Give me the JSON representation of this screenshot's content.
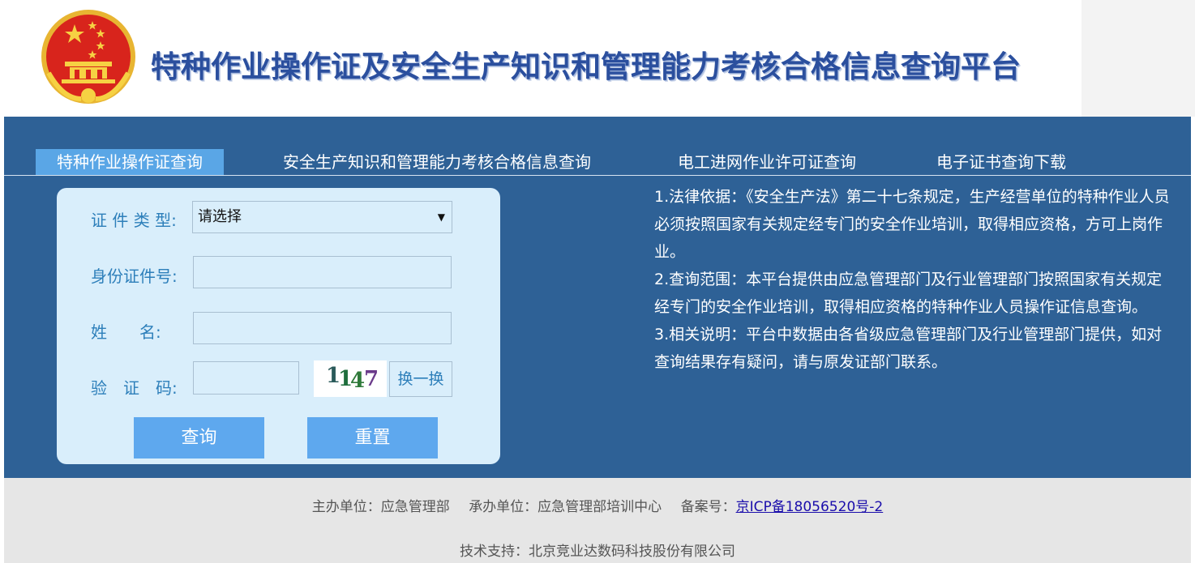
{
  "header": {
    "title": "特种作业操作证及安全生产知识和管理能力考核合格信息查询平台"
  },
  "tabs": [
    {
      "label": "特种作业操作证查询",
      "active": true
    },
    {
      "label": "安全生产知识和管理能力考核合格信息查询",
      "active": false
    },
    {
      "label": "电工进网作业许可证查询",
      "active": false
    },
    {
      "label": "电子证书查询下载",
      "active": false
    }
  ],
  "form": {
    "cert_type_label": "证 件 类 型:",
    "cert_type_value": "请选择",
    "id_label": "身份证件号:",
    "id_value": "",
    "name_label": "姓　　名:",
    "name_value": "",
    "captcha_label": "验　证　码:",
    "captcha_value": "",
    "captcha_text": "1147",
    "swap_label": "换一换",
    "query_button": "查询",
    "reset_button": "重置"
  },
  "info": {
    "p1": "1.法律依据：《安全生产法》第二十七条规定，生产经营单位的特种作业人员必须按照国家有关规定经专门的安全作业培训，取得相应资格，方可上岗作业。",
    "p2": "2.查询范围：本平台提供由应急管理部门及行业管理部门按照国家有关规定经专门的安全作业培训，取得相应资格的特种作业人员操作证信息查询。",
    "p3": "3.相关说明：平台中数据由各省级应急管理部门及行业管理部门提供，如对查询结果存有疑问，请与原发证部门联系。"
  },
  "footer": {
    "host": "主办单位：应急管理部",
    "organizer": "承办单位：应急管理部培训中心",
    "record_label": "备案号：",
    "record_link": "京ICP备18056520号-2",
    "support": "技术支持：北京竞业达数码科技股份有限公司"
  },
  "colors": {
    "main_bg": "#2e6196",
    "active_tab": "#5aa6e6",
    "panel_bg": "#d9eefb",
    "button": "#5ea8ee",
    "title": "#2b4f9e"
  }
}
